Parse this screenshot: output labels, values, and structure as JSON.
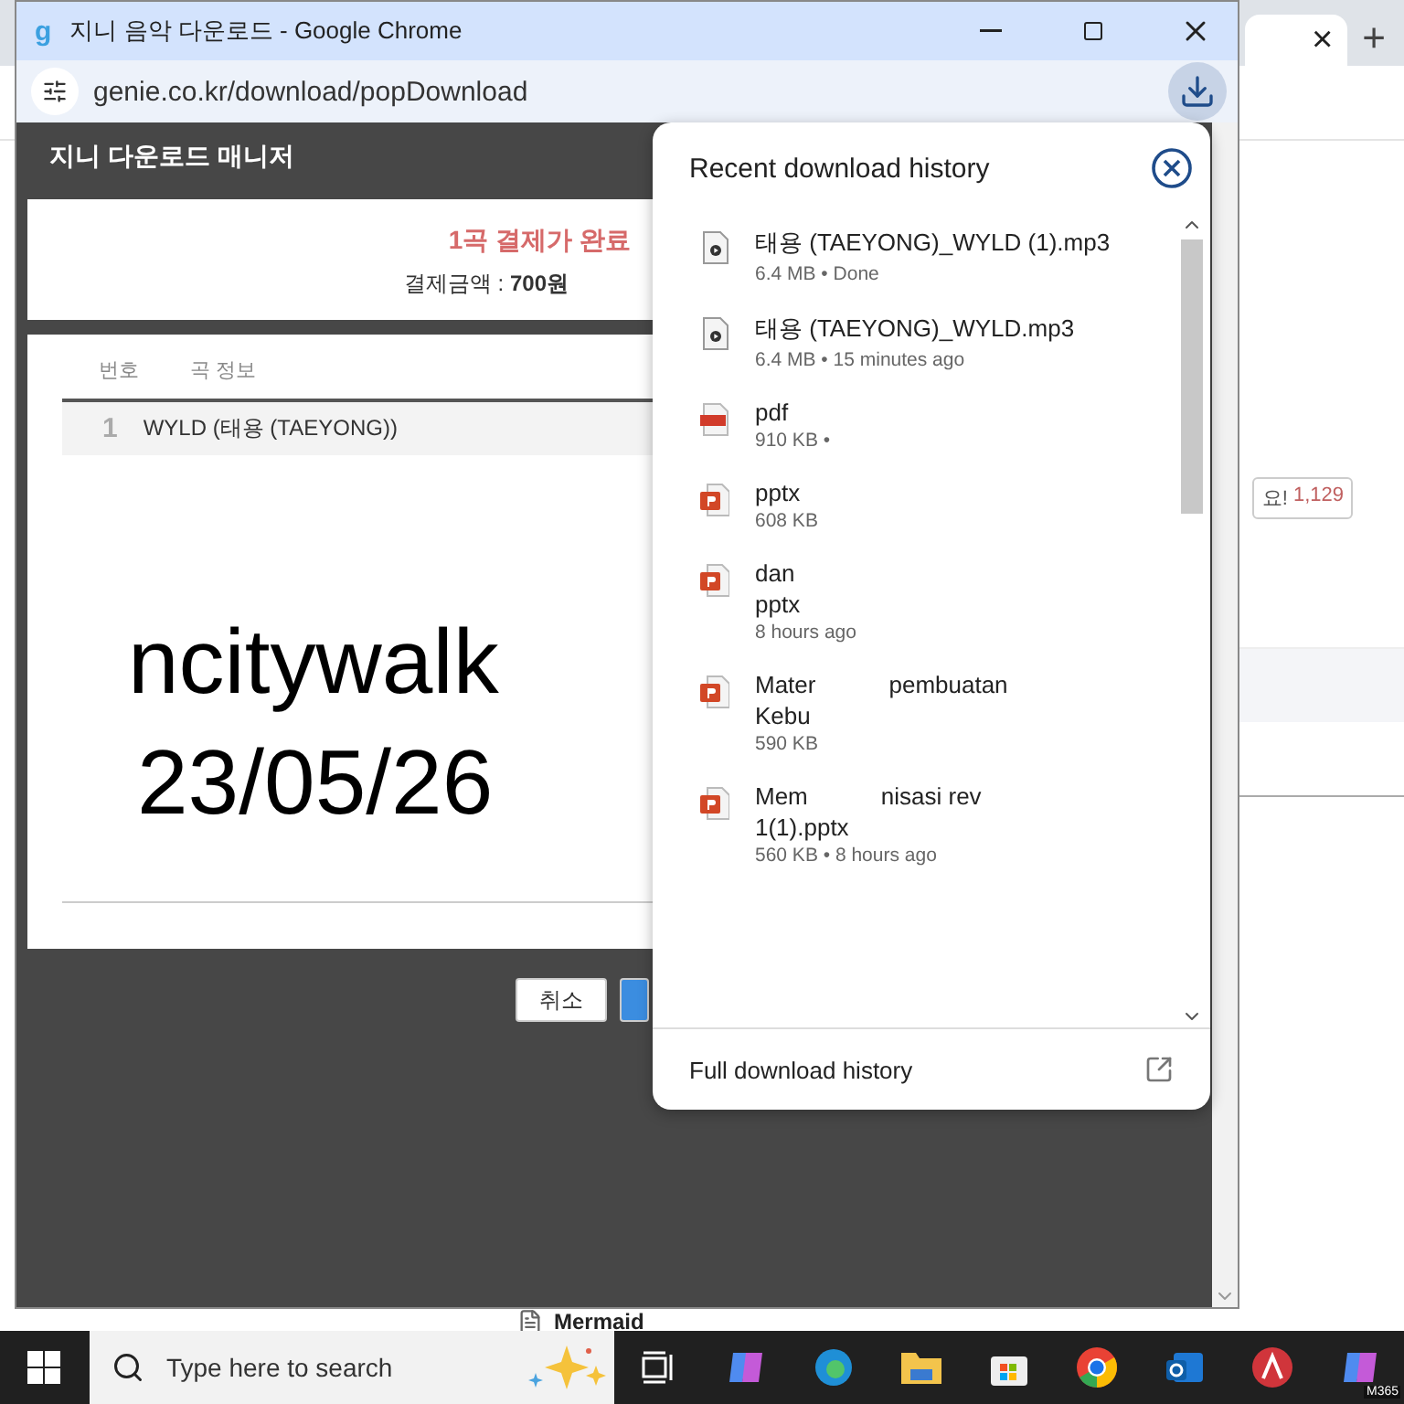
{
  "background_browser": {
    "tab_close": "×",
    "new_tab": "+",
    "like_badge": {
      "label": "요!",
      "count": "1,129"
    },
    "sidebar_item": "Mermaid"
  },
  "window": {
    "favicon": "g",
    "title": "지니 음악 다운로드 - Google Chrome",
    "address": "genie.co.kr/download/popDownload"
  },
  "page": {
    "header": "지니 다운로드 매니저",
    "notice": "1곡 결제가 완료",
    "amount": "결제금액 : **700원**",
    "columns": [
      "번호",
      "곡 정보"
    ],
    "rows": [
      {
        "number": "1",
        "title": "WYLD (태용 (TAEYONG))"
      }
    ],
    "overlay_note": [
      "ncitywalk",
      "23/05/26"
    ],
    "buttons": [
      {
        "kind": "secondary",
        "label": "취소"
      },
      {
        "kind": "primary"
      }
    ]
  },
  "downloads_panel": {
    "title": "Recent download history",
    "items": [
      {
        "kind": "audio",
        "lines": [
          [
            "태용 (TAEYONG)_WYLD (1).mp3"
          ]
        ],
        "meta": "6.4 MB • Done"
      },
      {
        "kind": "audio",
        "lines": [
          [
            "태용 (TAEYONG)_WYLD.mp3"
          ]
        ],
        "meta": "6.4 MB • 15 minutes ago"
      },
      {
        "kind": "pdf",
        "lines": [
          [
            "pdf"
          ]
        ],
        "meta": "910 KB •"
      },
      {
        "kind": "slides",
        "lines": [
          [
            "pptx"
          ]
        ],
        "meta": "608 KB"
      },
      {
        "kind": "slides",
        "lines": [
          [
            "dan"
          ],
          [
            "pptx"
          ]
        ],
        "meta": "8 hours ago"
      },
      {
        "kind": "slides",
        "lines": [
          [
            "Mater",
            "pembuatan"
          ],
          [
            "Kebu"
          ]
        ],
        "meta": "590 KB"
      },
      {
        "kind": "slides",
        "lines": [
          [
            "Mem",
            "nisasi rev"
          ],
          [
            "1(1).pptx"
          ]
        ],
        "meta": "560 KB • 8 hours ago"
      }
    ],
    "footer": "Full download history"
  },
  "taskbar": {
    "search_placeholder": "Type here to search",
    "app_badge": "M365"
  }
}
